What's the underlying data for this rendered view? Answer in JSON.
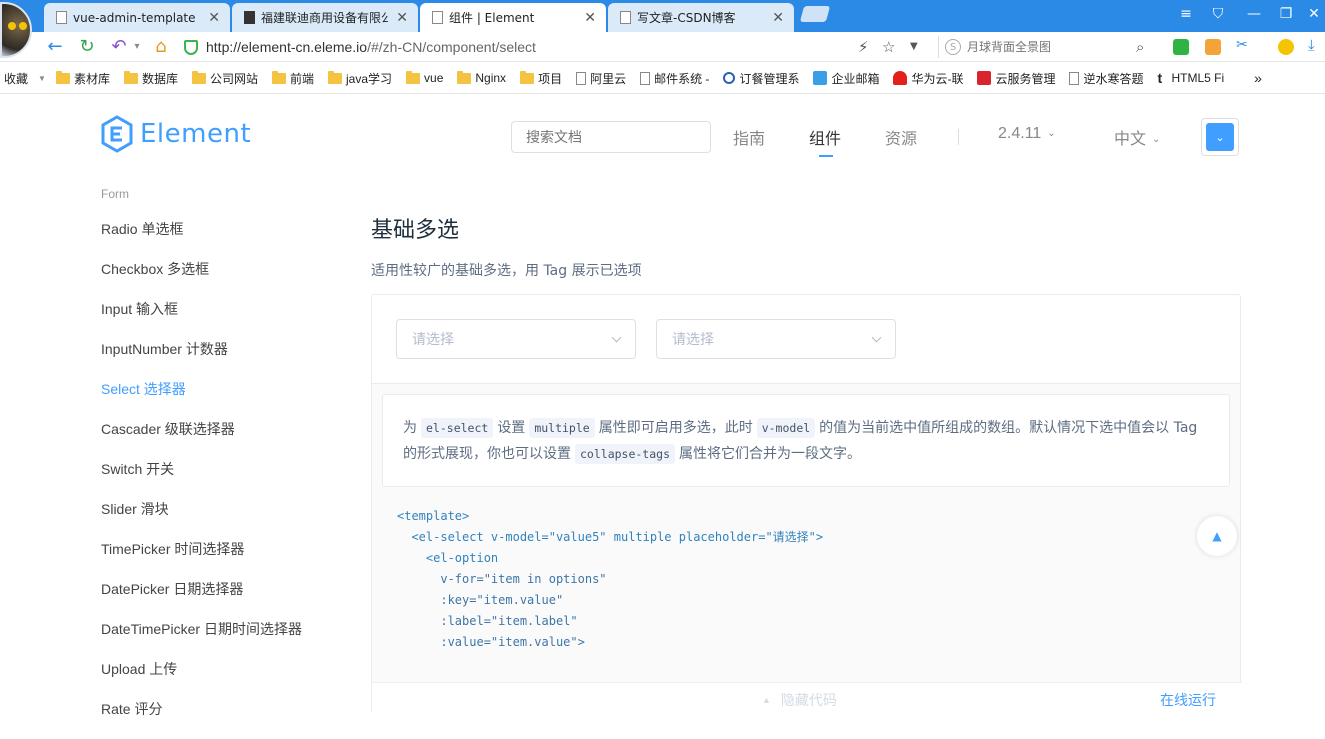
{
  "browser": {
    "tabs": [
      {
        "label": "vue-admin-template",
        "active": false
      },
      {
        "label": "福建联迪商用设备有限公",
        "active": false
      },
      {
        "label": "组件 | Element",
        "active": true
      },
      {
        "label": "写文章-CSDN博客",
        "active": false
      }
    ],
    "url_host": "http://element-cn.eleme.io",
    "url_path": "/#/zh-CN/component/select",
    "search_placeholder": "月球背面全景图",
    "bookmarks_label": "收藏",
    "bookmarks": [
      {
        "label": "素材库",
        "icon": "folder-icon"
      },
      {
        "label": "数据库",
        "icon": "folder-icon"
      },
      {
        "label": "公司网站",
        "icon": "folder-icon"
      },
      {
        "label": "前端",
        "icon": "folder-icon"
      },
      {
        "label": "java学习",
        "icon": "folder-icon"
      },
      {
        "label": "vue",
        "icon": "folder-icon"
      },
      {
        "label": "Nginx",
        "icon": "folder-icon"
      },
      {
        "label": "项目",
        "icon": "folder-icon"
      },
      {
        "label": "阿里云",
        "icon": "page-icon"
      },
      {
        "label": "邮件系统 -",
        "icon": "page-icon"
      },
      {
        "label": "订餐管理系",
        "icon": "site-icon"
      },
      {
        "label": "企业邮箱",
        "icon": "mail-icon"
      },
      {
        "label": "华为云-联",
        "icon": "huawei-icon"
      },
      {
        "label": "云服务管理",
        "icon": "cloud-icon"
      },
      {
        "label": "逆水寒答题",
        "icon": "page-icon"
      },
      {
        "label": "HTML5 Fi",
        "icon": "tumblr-icon"
      }
    ],
    "more_label": "»"
  },
  "site": {
    "logo_text": "Element",
    "search_placeholder": "搜索文档",
    "nav": [
      {
        "label": "指南",
        "active": false
      },
      {
        "label": "组件",
        "active": true
      },
      {
        "label": "资源",
        "active": false
      }
    ],
    "version": "2.4.11",
    "language": "中文",
    "accent": "#409eff"
  },
  "sidebar": {
    "group": "Form",
    "items": [
      {
        "label": "Radio 单选框",
        "active": false
      },
      {
        "label": "Checkbox 多选框",
        "active": false
      },
      {
        "label": "Input 输入框",
        "active": false
      },
      {
        "label": "InputNumber 计数器",
        "active": false
      },
      {
        "label": "Select 选择器",
        "active": true
      },
      {
        "label": "Cascader 级联选择器",
        "active": false
      },
      {
        "label": "Switch 开关",
        "active": false
      },
      {
        "label": "Slider 滑块",
        "active": false
      },
      {
        "label": "TimePicker 时间选择器",
        "active": false
      },
      {
        "label": "DatePicker 日期选择器",
        "active": false
      },
      {
        "label": "DateTimePicker 日期时间选择器",
        "active": false
      },
      {
        "label": "Upload 上传",
        "active": false
      },
      {
        "label": "Rate 评分",
        "active": false
      }
    ]
  },
  "main": {
    "title": "基础多选",
    "description": "适用性较广的基础多选，用 Tag 展示已选项",
    "select1_placeholder": "请选择",
    "select2_placeholder": "请选择",
    "tip": {
      "t1": "为",
      "c1": "el-select",
      "t2": "设置",
      "c2": "multiple",
      "t3": "属性即可启用多选，此时",
      "c3": "v-model",
      "t4": "的值为当前选中值所组成的数组。默认情况下选中值会以 Tag 的形式展现，你也可以设置",
      "c4": "collapse-tags",
      "t5": "属性将它们合并为一段文字。"
    },
    "code_lines": [
      "<template>",
      "  <el-select v-model=\"value5\" multiple placeholder=\"请选择\">",
      "    <el-option",
      "      v-for=\"item in options\"",
      "      :key=\"item.value\"",
      "      :label=\"item.label\"",
      "      :value=\"item.value\">"
    ],
    "hide_code": "隐藏代码",
    "run_online": "在线运行"
  }
}
